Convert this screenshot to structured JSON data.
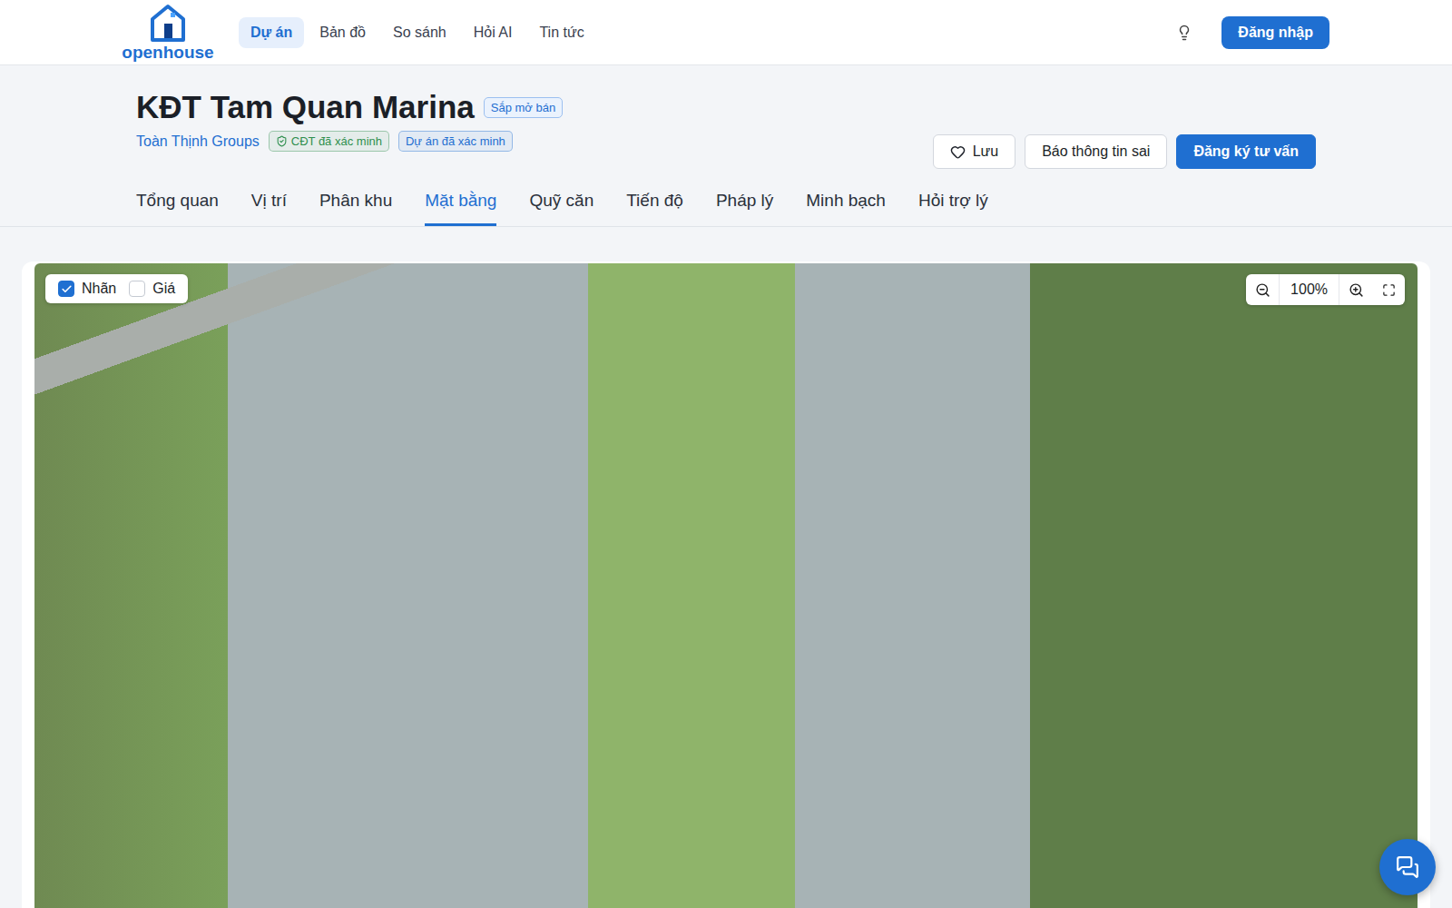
{
  "header": {
    "logo": "openhouse",
    "nav": [
      {
        "label": "Dự án",
        "selected": true
      },
      {
        "label": "Bản đồ",
        "selected": false
      },
      {
        "label": "So sánh",
        "selected": false
      },
      {
        "label": "Hỏi AI",
        "selected": false
      },
      {
        "label": "Tin tức",
        "selected": false
      }
    ],
    "login": "Đăng nhập"
  },
  "project": {
    "title": "KĐT Tam Quan Marina",
    "status": "Sắp mở bán",
    "developer": "Toàn Thịnh Groups",
    "badges": [
      {
        "label": "CĐT đã xác minh",
        "kind": "shield",
        "color": "#2f8f4e"
      },
      {
        "label": "Dự án đã xác minh",
        "kind": "plain",
        "color": "#1f6fd1"
      }
    ],
    "actions": [
      {
        "label": "Lưu",
        "kind": "save"
      },
      {
        "label": "Báo thông tin sai",
        "kind": "outline"
      },
      {
        "label": "Đăng ký tư vấn",
        "kind": "primary"
      }
    ]
  },
  "tabs": [
    {
      "label": "Tổng quan",
      "selected": false
    },
    {
      "label": "Vị trí",
      "selected": false
    },
    {
      "label": "Phân khu",
      "selected": false
    },
    {
      "label": "Mặt bằng",
      "selected": true
    },
    {
      "label": "Quỹ căn",
      "selected": false
    },
    {
      "label": "Tiến độ",
      "selected": false
    },
    {
      "label": "Pháp lý",
      "selected": false
    },
    {
      "label": "Minh bạch",
      "selected": false
    },
    {
      "label": "Hỏi trợ lý",
      "selected": false
    }
  ],
  "map": {
    "layers": [
      {
        "label": "Nhãn",
        "checked": true
      },
      {
        "label": "Giá",
        "checked": false
      }
    ],
    "zoom": "100%"
  }
}
